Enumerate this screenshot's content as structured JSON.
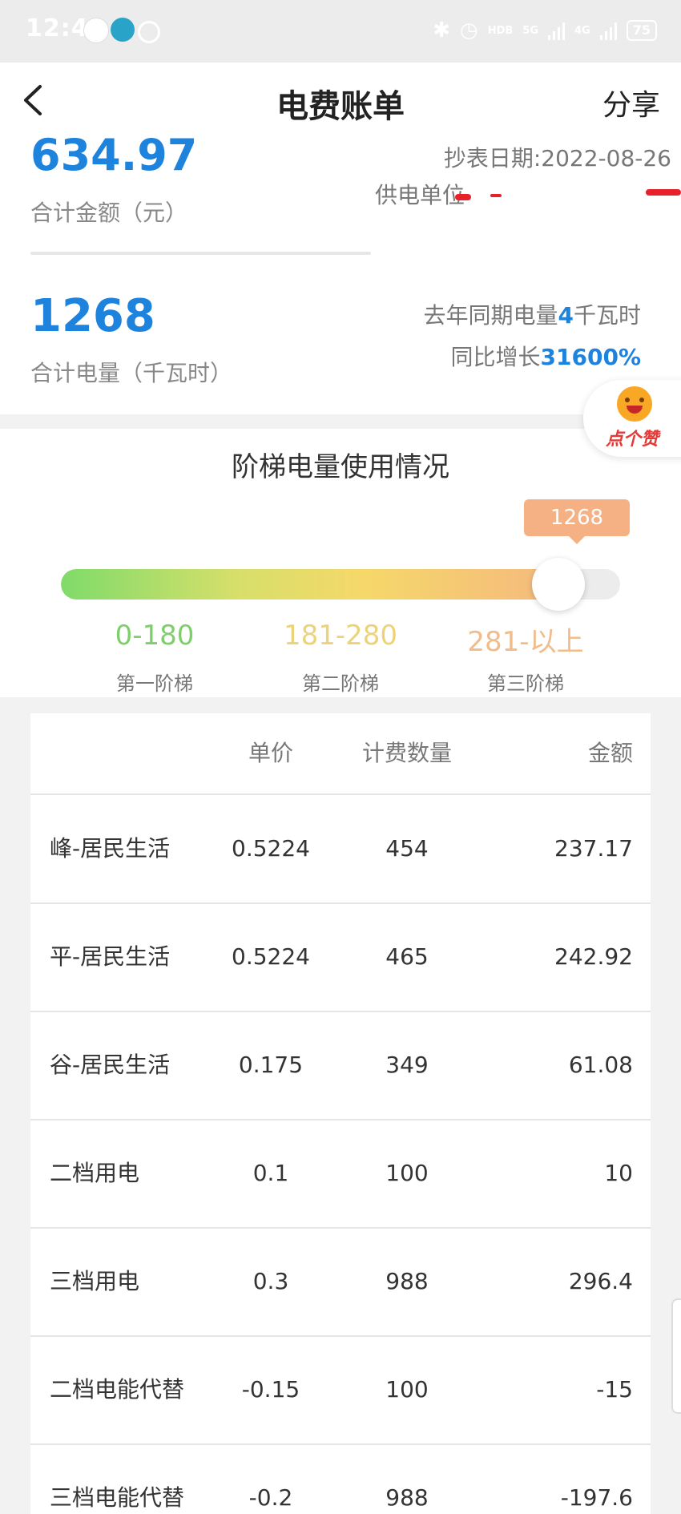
{
  "status_bar": {
    "time": "12:49",
    "network_hd": "HDB",
    "network_5g": "5G",
    "network_4g": "4G",
    "battery": "75"
  },
  "header": {
    "title": "电费账单",
    "share_label": "分享"
  },
  "summary": {
    "total_amount": "634.97",
    "total_amount_label": "合计金额（元）",
    "reading_date": "抄表日期:2022-08-26",
    "supply_unit_label": "供电单位",
    "total_energy": "1268",
    "total_energy_label": "合计电量（千瓦时）",
    "yoy_prefix": "去年同期电量",
    "yoy_value": "4",
    "yoy_unit": "千瓦时",
    "growth_prefix": "同比增长",
    "growth_value": "31600%"
  },
  "like_button": {
    "label": "点个赞"
  },
  "tier": {
    "title": "阶梯电量使用情况",
    "current_usage": "1268",
    "fill_fraction": 0.9,
    "ranges": [
      {
        "range": "0-180",
        "name": "第一阶梯",
        "color": "#7ecf6a"
      },
      {
        "range": "181-280",
        "name": "第二阶梯",
        "color": "#ecd37a"
      },
      {
        "range": "281-以上",
        "name": "第三阶梯",
        "color": "#f0bc8c"
      }
    ]
  },
  "table": {
    "headers": [
      "",
      "单价",
      "计费数量",
      "金额"
    ],
    "rows": [
      {
        "name": "峰-居民生活",
        "price": "0.5224",
        "qty": "454",
        "amount": "237.17"
      },
      {
        "name": "平-居民生活",
        "price": "0.5224",
        "qty": "465",
        "amount": "242.92"
      },
      {
        "name": "谷-居民生活",
        "price": "0.175",
        "qty": "349",
        "amount": "61.08"
      },
      {
        "name": "二档用电",
        "price": "0.1",
        "qty": "100",
        "amount": "10"
      },
      {
        "name": "三档用电",
        "price": "0.3",
        "qty": "988",
        "amount": "296.4"
      },
      {
        "name": "二档电能代替",
        "price": "-0.15",
        "qty": "100",
        "amount": "-15"
      },
      {
        "name": "三档电能代替",
        "price": "-0.2",
        "qty": "988",
        "amount": "-197.6"
      }
    ]
  }
}
